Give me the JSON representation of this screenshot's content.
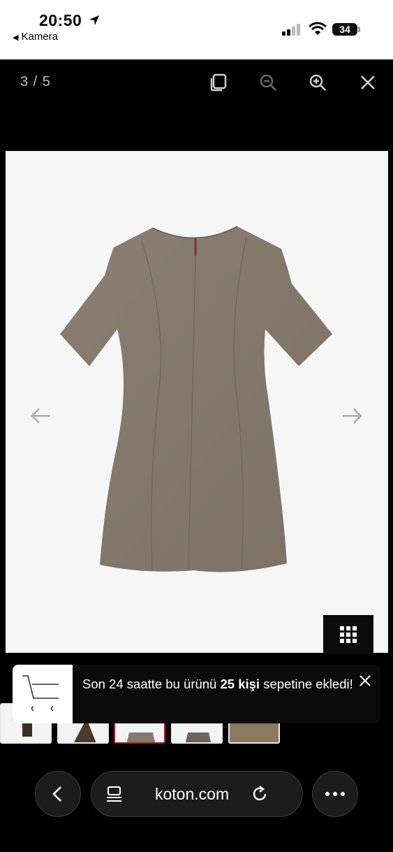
{
  "status_bar": {
    "time": "20:50",
    "back_app": "Kamera",
    "battery": "34"
  },
  "viewer": {
    "counter": "3 / 5",
    "icons": [
      "copy-icon",
      "zoom-out-icon",
      "zoom-in-icon",
      "close-icon",
      "arrow-left-icon",
      "arrow-right-icon",
      "grid-icon"
    ]
  },
  "toast": {
    "text_before": "Son 24 saatte bu ürünü ",
    "count": "25",
    "unit": " kişi",
    "text_after": " sepetine ekledi!"
  },
  "browser": {
    "url": "koton.com"
  },
  "colors": {
    "background": "#000000",
    "product_bg": "#f6f6f6",
    "dress": "#857a6d",
    "active_thumb": "#a82020"
  }
}
